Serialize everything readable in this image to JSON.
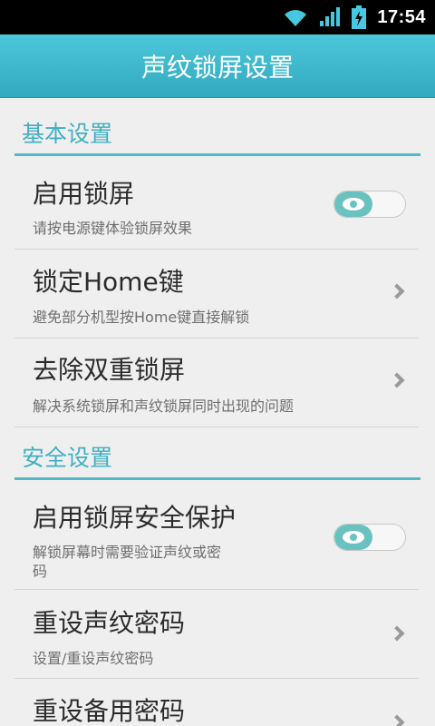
{
  "status_bar": {
    "time": "17:54",
    "icons": [
      "wifi-icon",
      "signal-icon",
      "battery-charging-icon"
    ]
  },
  "header": {
    "title": "声纹锁屏设置"
  },
  "sections": [
    {
      "title": "基本设置",
      "items": [
        {
          "title": "启用锁屏",
          "subtitle": "请按电源键体验锁屏效果",
          "control": "toggle",
          "enabled": true
        },
        {
          "title": "锁定Home键",
          "subtitle": "避免部分机型按Home键直接解锁",
          "control": "chevron-right-icon"
        },
        {
          "title": "去除双重锁屏",
          "subtitle": "解决系统锁屏和声纹锁屏同时出现的问题",
          "control": "chevron-right-icon"
        }
      ]
    },
    {
      "title": "安全设置",
      "items": [
        {
          "title": "启用锁屏安全保护",
          "subtitle_line1": "解锁屏幕时需要验证声纹或密",
          "subtitle_line2": "码",
          "control": "toggle",
          "enabled": true
        },
        {
          "title": "重设声纹密码",
          "subtitle": "设置/重设声纹密码",
          "control": "chevron-right-icon"
        },
        {
          "title": "重设备用密码",
          "control": "chevron-right-icon"
        }
      ]
    }
  ],
  "colors": {
    "accent": "#3fb0c2",
    "title_bar": "#3db6cb",
    "toggle_on": "#6ac2c0",
    "background": "#efefef"
  }
}
